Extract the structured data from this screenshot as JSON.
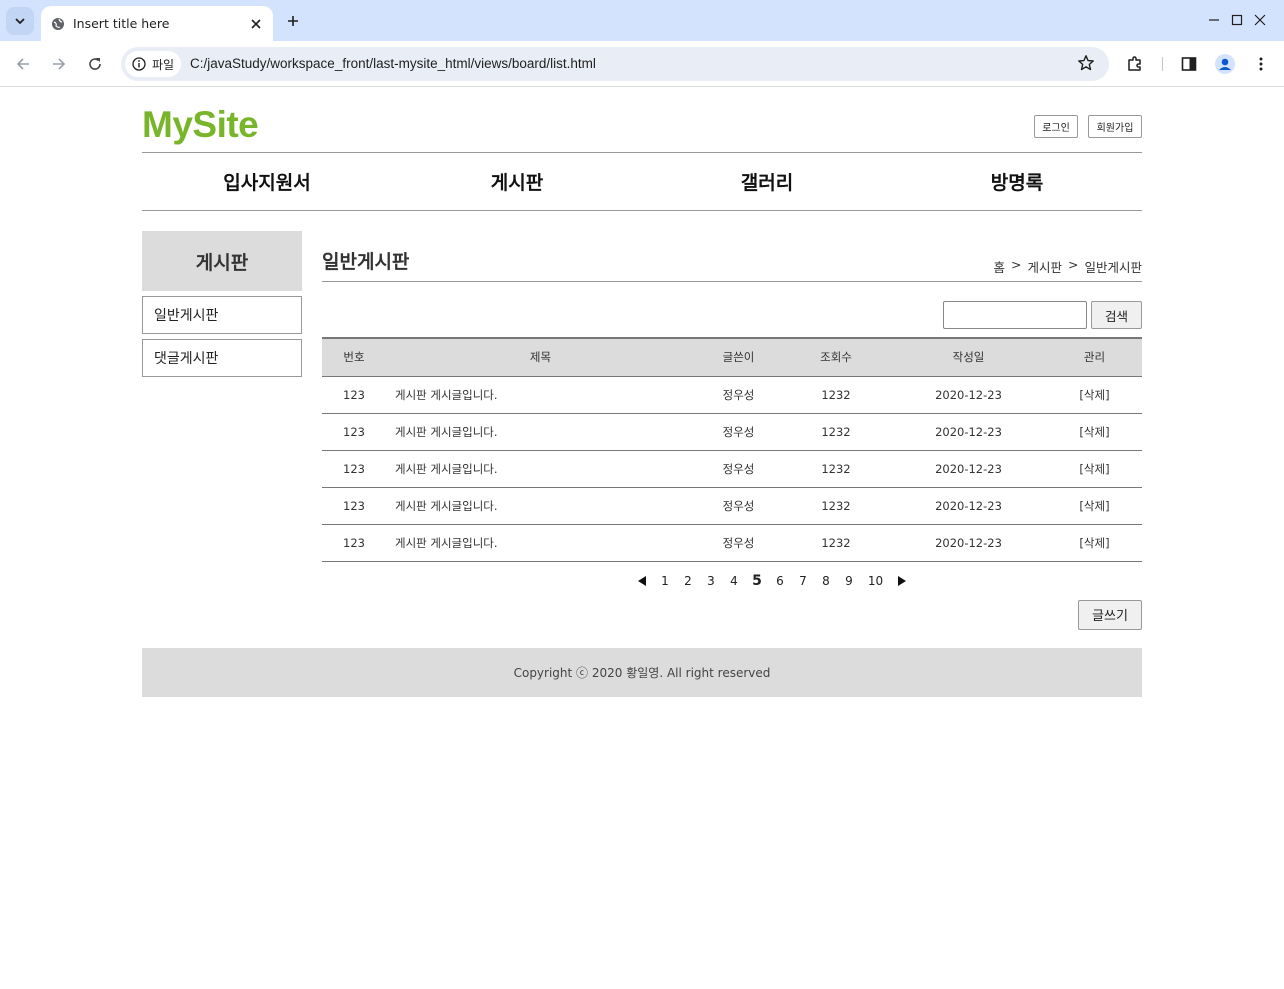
{
  "browser": {
    "tab_title": "Insert title here",
    "chip_label": "파일",
    "url": "C:/javaStudy/workspace_front/last-mysite_html/views/board/list.html"
  },
  "site": {
    "logo": "MySite",
    "login_label": "로그인",
    "join_label": "회원가입"
  },
  "nav": {
    "items": [
      "입사지원서",
      "게시판",
      "갤러리",
      "방명록"
    ]
  },
  "aside": {
    "title": "게시판",
    "items": [
      "일반게시판",
      "댓글게시판"
    ]
  },
  "content": {
    "title": "일반게시판",
    "breadcrumb": [
      "홈",
      ">",
      "게시판",
      ">",
      "일반게시판"
    ],
    "search_button": "검색",
    "write_button": "글쓰기"
  },
  "board": {
    "columns": [
      "번호",
      "제목",
      "글쓴이",
      "조회수",
      "작성일",
      "관리"
    ],
    "rows": [
      {
        "no": "123",
        "title": "게시판 게시글입니다.",
        "author": "정우성",
        "views": "1232",
        "date": "2020-12-23",
        "action": "[삭제]"
      },
      {
        "no": "123",
        "title": "게시판 게시글입니다.",
        "author": "정우성",
        "views": "1232",
        "date": "2020-12-23",
        "action": "[삭제]"
      },
      {
        "no": "123",
        "title": "게시판 게시글입니다.",
        "author": "정우성",
        "views": "1232",
        "date": "2020-12-23",
        "action": "[삭제]"
      },
      {
        "no": "123",
        "title": "게시판 게시글입니다.",
        "author": "정우성",
        "views": "1232",
        "date": "2020-12-23",
        "action": "[삭제]"
      },
      {
        "no": "123",
        "title": "게시판 게시글입니다.",
        "author": "정우성",
        "views": "1232",
        "date": "2020-12-23",
        "action": "[삭제]"
      }
    ]
  },
  "pagination": {
    "pages": [
      "1",
      "2",
      "3",
      "4",
      "5",
      "6",
      "7",
      "8",
      "9",
      "10"
    ],
    "current": "5"
  },
  "footer": {
    "text": "Copyright ⓒ 2020 황일영. All right reserved"
  },
  "colors": {
    "brand": "#78b52a",
    "tabbar": "#d3e3fd",
    "gray_panel": "#dcdcdc"
  }
}
